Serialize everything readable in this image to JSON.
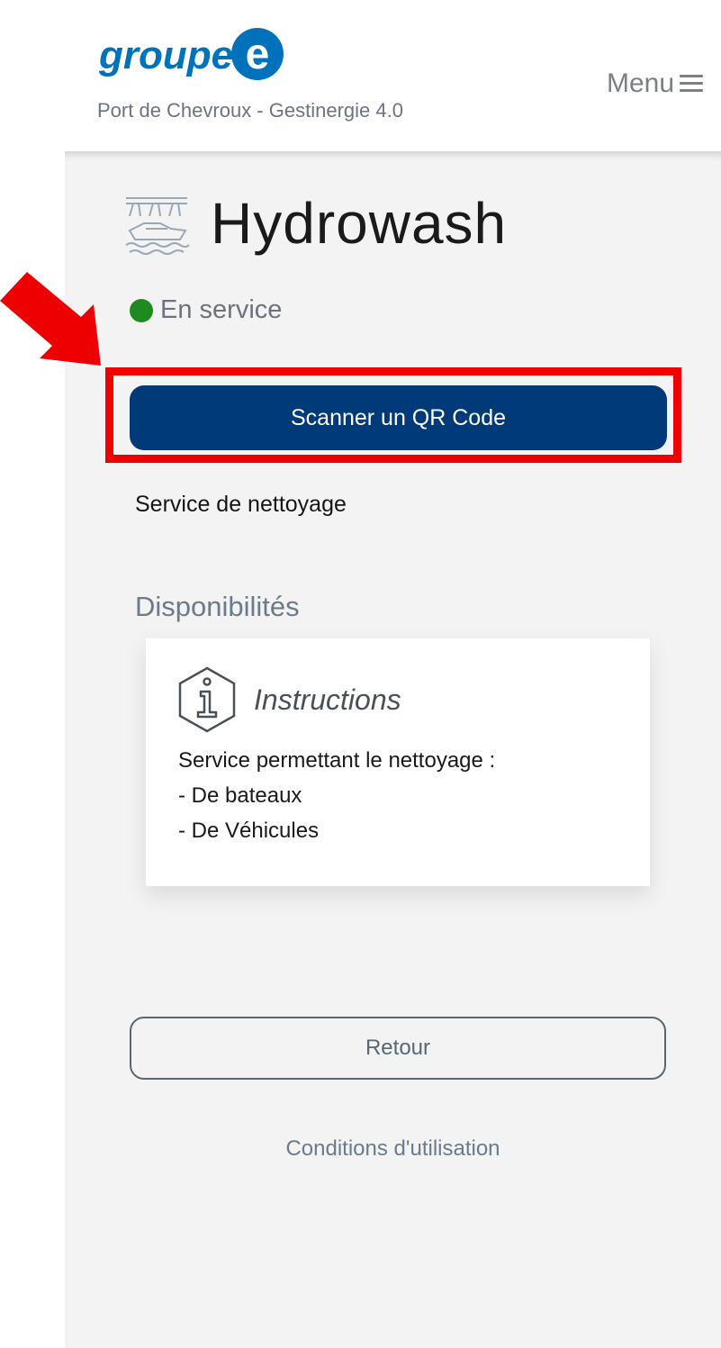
{
  "header": {
    "logo_text": "groupe",
    "logo_letter": "e",
    "subtitle": "Port de Chevroux - Gestinergie 4.0",
    "menu_label": "Menu"
  },
  "page": {
    "title": "Hydrowash",
    "status": "En service",
    "scan_button": "Scanner un QR Code",
    "service_description": "Service de nettoyage",
    "availability_heading": "Disponibilités"
  },
  "instructions": {
    "title": "Instructions",
    "lines": [
      "Service permettant le nettoyage :",
      "- De bateaux",
      "- De Véhicules"
    ]
  },
  "footer": {
    "back_button": "Retour",
    "terms_link": "Conditions d'utilisation"
  },
  "colors": {
    "primary_button": "#003a78",
    "status_ok": "#1f8a1f",
    "annotation": "#ee0000",
    "logo_blue": "#0072bc"
  },
  "icons": {
    "title_icon": "boat-wash-icon",
    "status_icon": "status-dot-icon",
    "info_icon": "info-icon",
    "menu_icon": "hamburger-icon",
    "annotation_arrow": "arrow-annotation"
  }
}
